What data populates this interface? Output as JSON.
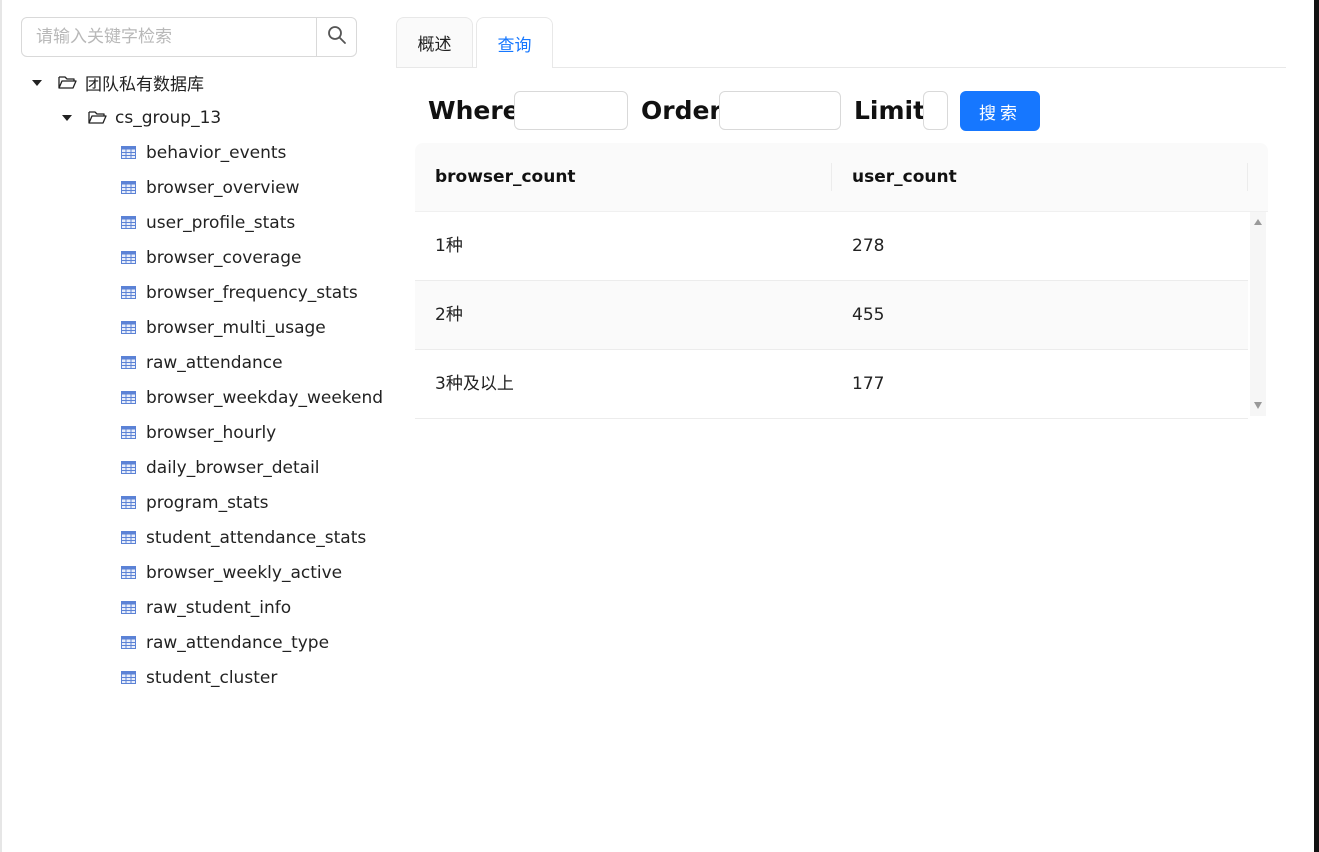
{
  "search": {
    "placeholder": "请输入关键字检索",
    "icon": "search-icon"
  },
  "tree": {
    "root": {
      "label": "团队私有数据库",
      "icon": "folder-open-icon"
    },
    "group": {
      "label": "cs_group_13",
      "icon": "folder-open-icon"
    },
    "tables": [
      "behavior_events",
      "browser_overview",
      "user_profile_stats",
      "browser_coverage",
      "browser_frequency_stats",
      "browser_multi_usage",
      "raw_attendance",
      "browser_weekday_weekend",
      "browser_hourly",
      "daily_browser_detail",
      "program_stats",
      "student_attendance_stats",
      "browser_weekly_active",
      "raw_student_info",
      "raw_attendance_type",
      "student_cluster"
    ]
  },
  "tabs": [
    {
      "label": "概述",
      "active": false
    },
    {
      "label": "查询",
      "active": true
    }
  ],
  "query": {
    "where_label": "Where",
    "where_value": "",
    "order_label": "Order",
    "order_value": "",
    "limit_label": "Limit",
    "limit_value": "",
    "search_button": "搜索"
  },
  "result_table": {
    "columns": [
      "browser_count",
      "user_count"
    ],
    "rows": [
      [
        "1种",
        "278"
      ],
      [
        "2种",
        "455"
      ],
      [
        "3种及以上",
        "177"
      ]
    ]
  },
  "colors": {
    "accent": "#1677ff",
    "header_bg": "#fafafa",
    "stripe_bg": "#fafafa"
  }
}
